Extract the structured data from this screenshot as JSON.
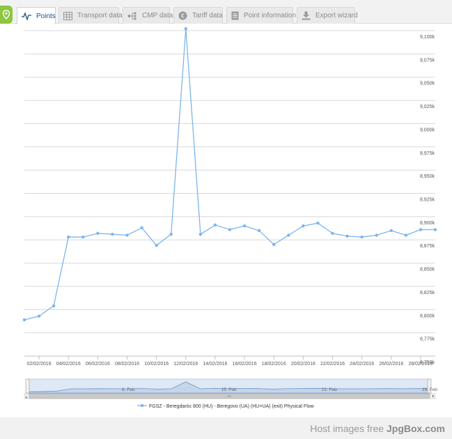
{
  "tabs": [
    {
      "label": "Points",
      "icon": "pulse-icon",
      "active": true
    },
    {
      "label": "Transport data",
      "icon": "table-icon",
      "active": false
    },
    {
      "label": "CMP data",
      "icon": "network-icon",
      "active": false
    },
    {
      "label": "Tariff data",
      "icon": "euro-icon",
      "active": false
    },
    {
      "label": "Point information",
      "icon": "document-icon",
      "active": false
    },
    {
      "label": "Export wizard",
      "icon": "download-icon",
      "active": false
    }
  ],
  "colors": {
    "series": "#7cb5ec",
    "accent": "#8dc63f",
    "tab_active_text": "#1c4f7c"
  },
  "chart_data": {
    "type": "line",
    "title": "",
    "xlabel": "",
    "ylabel": "",
    "ylim": [
      8750,
      9100
    ],
    "yticks": [
      "8,750k",
      "8,775k",
      "8,800k",
      "8,825k",
      "8,850k",
      "8,875k",
      "8,900k",
      "8,925k",
      "8,950k",
      "8,975k",
      "9,000k",
      "9,025k",
      "9,050k",
      "9,075k",
      "9,100k"
    ],
    "xticks": [
      "02/02/2016",
      "04/02/2016",
      "06/02/2016",
      "08/02/2016",
      "10/02/2016",
      "12/02/2016",
      "14/02/2016",
      "16/02/2016",
      "18/02/2016",
      "20/02/2016",
      "22/02/2016",
      "24/02/2016",
      "26/02/2016",
      "28/02/2016"
    ],
    "grid": true,
    "legend_position": "bottom-center",
    "series": [
      {
        "name": "FGSZ - Beregdaróc 800 (HU) - Beregovo (UA) (HU>UA) (exit) Physical Flow",
        "x": [
          "01/02/2016",
          "02/02/2016",
          "03/02/2016",
          "04/02/2016",
          "05/02/2016",
          "06/02/2016",
          "07/02/2016",
          "08/02/2016",
          "09/02/2016",
          "10/02/2016",
          "11/02/2016",
          "12/02/2016",
          "13/02/2016",
          "14/02/2016",
          "15/02/2016",
          "16/02/2016",
          "17/02/2016",
          "18/02/2016",
          "19/02/2016",
          "20/02/2016",
          "21/02/2016",
          "22/02/2016",
          "23/02/2016",
          "24/02/2016",
          "25/02/2016",
          "26/02/2016",
          "27/02/2016",
          "28/02/2016",
          "29/02/2016"
        ],
        "values": [
          8789,
          8793,
          8804,
          8878,
          8878,
          8882,
          8881,
          8880,
          8888,
          8869,
          8881,
          9102,
          8881,
          8891,
          8886,
          8890,
          8885,
          8870,
          8880,
          8890,
          8893,
          8882,
          8879,
          8878,
          8880,
          8885,
          8880,
          8886,
          8886
        ]
      }
    ]
  },
  "navigator": {
    "labels": [
      "8. Feb",
      "15. Feb",
      "22. Feb",
      "29. Feb"
    ]
  },
  "footer": {
    "watermark_prefix": "Host images free ",
    "watermark_brand": "JpgBox.com"
  }
}
